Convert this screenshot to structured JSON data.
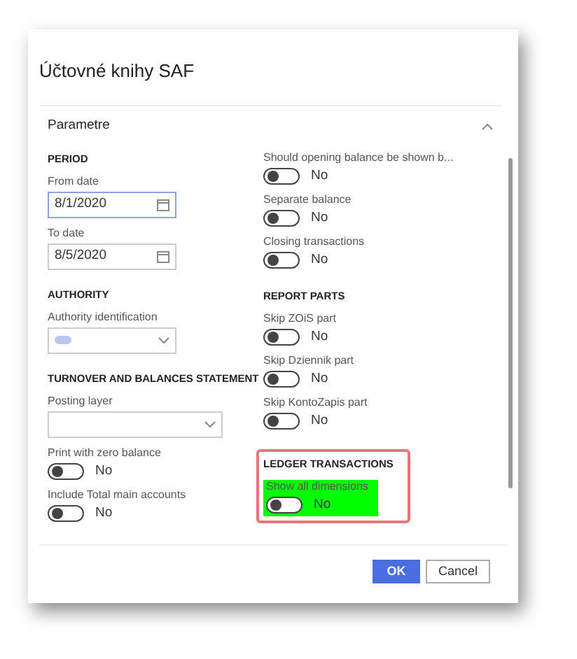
{
  "window": {
    "title": "Účtovné knihy SAF"
  },
  "section": {
    "title": "Parametre",
    "expanded": true
  },
  "left": [
    {
      "heading": "PERIOD",
      "fields": [
        {
          "kind": "date",
          "label": "From date",
          "value": "8/1/2020",
          "focused": true
        },
        {
          "kind": "date",
          "label": "To date",
          "value": "8/5/2020",
          "focused": false
        }
      ]
    },
    {
      "heading": "AUTHORITY",
      "fields": [
        {
          "kind": "select",
          "label": "Authority identification",
          "redacted": true
        }
      ]
    },
    {
      "heading": "TURNOVER AND BALANCES STATEMENT",
      "fields": [
        {
          "kind": "select",
          "label": "Posting layer",
          "redacted": false
        },
        {
          "kind": "toggle",
          "label": "Print with zero balance",
          "on": false,
          "state": "No"
        },
        {
          "kind": "toggle",
          "label": "Include Total main accounts",
          "on": false,
          "state": "No"
        }
      ]
    }
  ],
  "right": [
    {
      "fields": [
        {
          "kind": "toggle",
          "label": "Should opening balance be shown b...",
          "on": false,
          "state": "No"
        },
        {
          "kind": "toggle",
          "label": "Separate balance",
          "on": false,
          "state": "No"
        },
        {
          "kind": "toggle",
          "label": "Closing transactions",
          "on": false,
          "state": "No"
        }
      ]
    },
    {
      "heading": "REPORT PARTS",
      "fields": [
        {
          "kind": "toggle",
          "label": "Skip ZOiS part",
          "on": false,
          "state": "No"
        },
        {
          "kind": "toggle",
          "label": "Skip Dziennik part",
          "on": false,
          "state": "No"
        },
        {
          "kind": "toggle",
          "label": "Skip KontoZapis part",
          "on": false,
          "state": "No"
        }
      ]
    },
    {
      "heading": "LEDGER TRANSACTIONS",
      "highlighted": true,
      "fields": [
        {
          "kind": "toggle",
          "label": "Show all dimensions",
          "on": false,
          "state": "No"
        }
      ]
    }
  ],
  "buttons": [
    {
      "label": "OK",
      "primary": true
    },
    {
      "label": "Cancel",
      "primary": false
    }
  ]
}
